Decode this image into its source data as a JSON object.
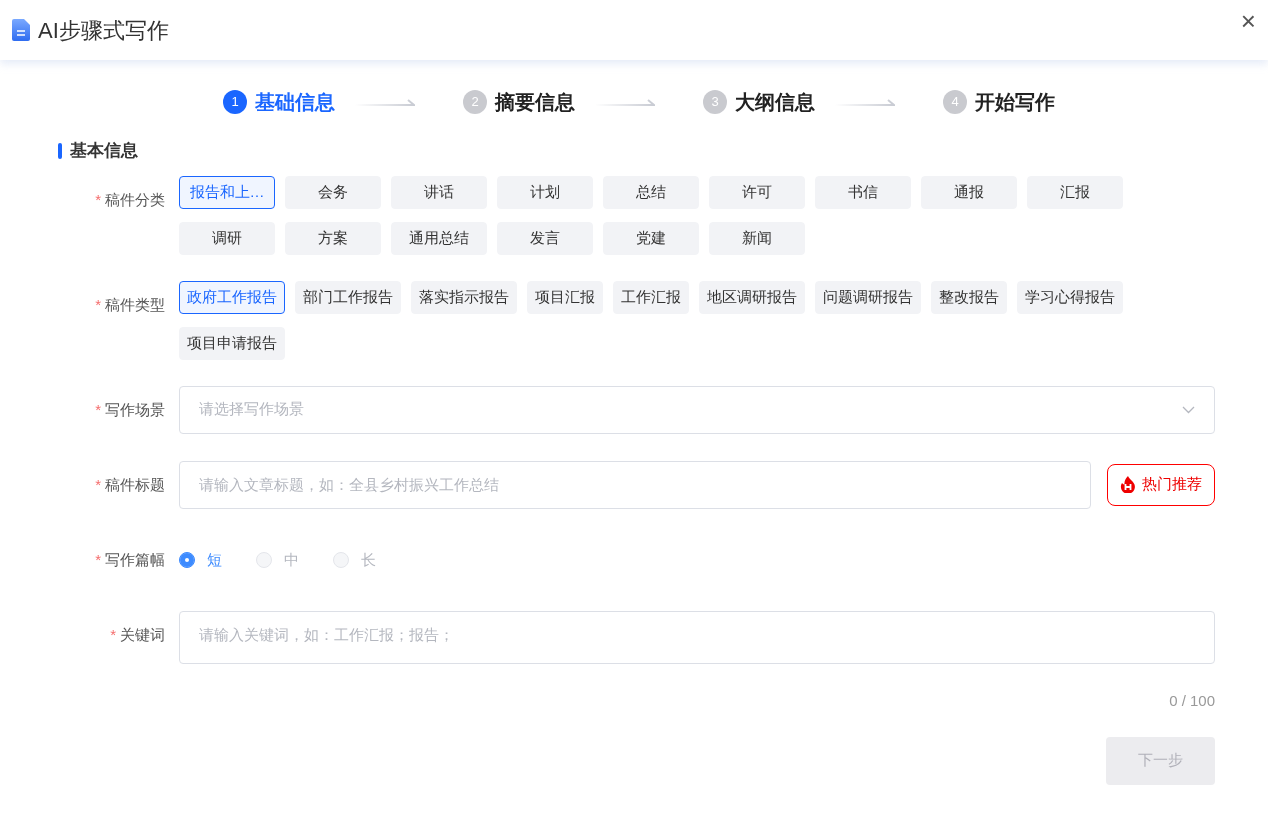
{
  "window": {
    "title": "AI步骤式写作",
    "close": "×"
  },
  "steps": [
    {
      "number": "1",
      "label": "基础信息",
      "selected": true
    },
    {
      "number": "2",
      "label": "摘要信息",
      "selected": false
    },
    {
      "number": "3",
      "label": "大纲信息",
      "selected": false
    },
    {
      "number": "4",
      "label": "开始写作",
      "selected": false
    }
  ],
  "section_title": "基本信息",
  "fields": [
    {
      "kind": "fixed_chips",
      "label": "稿件分类",
      "required_mark": "*",
      "options": [
        {
          "label": "报告和上…",
          "selected": true
        },
        {
          "label": "会务",
          "selected": false
        },
        {
          "label": "讲话",
          "selected": false
        },
        {
          "label": "计划",
          "selected": false
        },
        {
          "label": "总结",
          "selected": false
        },
        {
          "label": "许可",
          "selected": false
        },
        {
          "label": "书信",
          "selected": false
        },
        {
          "label": "通报",
          "selected": false
        },
        {
          "label": "汇报",
          "selected": false
        },
        {
          "label": "调研",
          "selected": false
        },
        {
          "label": "方案",
          "selected": false
        },
        {
          "label": "通用总结",
          "selected": false
        },
        {
          "label": "发言",
          "selected": false
        },
        {
          "label": "党建",
          "selected": false
        },
        {
          "label": "新闻",
          "selected": false
        }
      ]
    },
    {
      "kind": "chips",
      "label": "稿件类型",
      "required_mark": "*",
      "options": [
        {
          "label": "政府工作报告",
          "selected": true
        },
        {
          "label": "部门工作报告",
          "selected": false
        },
        {
          "label": "落实指示报告",
          "selected": false
        },
        {
          "label": "项目汇报",
          "selected": false
        },
        {
          "label": "工作汇报",
          "selected": false
        },
        {
          "label": "地区调研报告",
          "selected": false
        },
        {
          "label": "问题调研报告",
          "selected": false
        },
        {
          "label": "整改报告",
          "selected": false
        },
        {
          "label": "学习心得报告",
          "selected": false
        },
        {
          "label": "项目申请报告",
          "selected": false
        }
      ]
    },
    {
      "kind": "select",
      "label": "写作场景",
      "required_mark": "*",
      "placeholder": "请选择写作场景"
    },
    {
      "kind": "input_with_button",
      "label": "稿件标题",
      "required_mark": "*",
      "placeholder": "请输入文章标题，如：全县乡村振兴工作总结",
      "button": "热门推荐"
    },
    {
      "kind": "radio",
      "label": "写作篇幅",
      "required_mark": "*",
      "options": [
        {
          "label": "短",
          "selected": true
        },
        {
          "label": "中",
          "selected": false
        },
        {
          "label": "长",
          "selected": false
        }
      ]
    },
    {
      "kind": "textarea",
      "label": "关键词",
      "required_mark": "*",
      "placeholder": "请输入关键词，如：工作汇报；报告；",
      "counter": "0 / 100"
    }
  ],
  "next_button": {
    "label": "下一步",
    "disabled": true
  }
}
